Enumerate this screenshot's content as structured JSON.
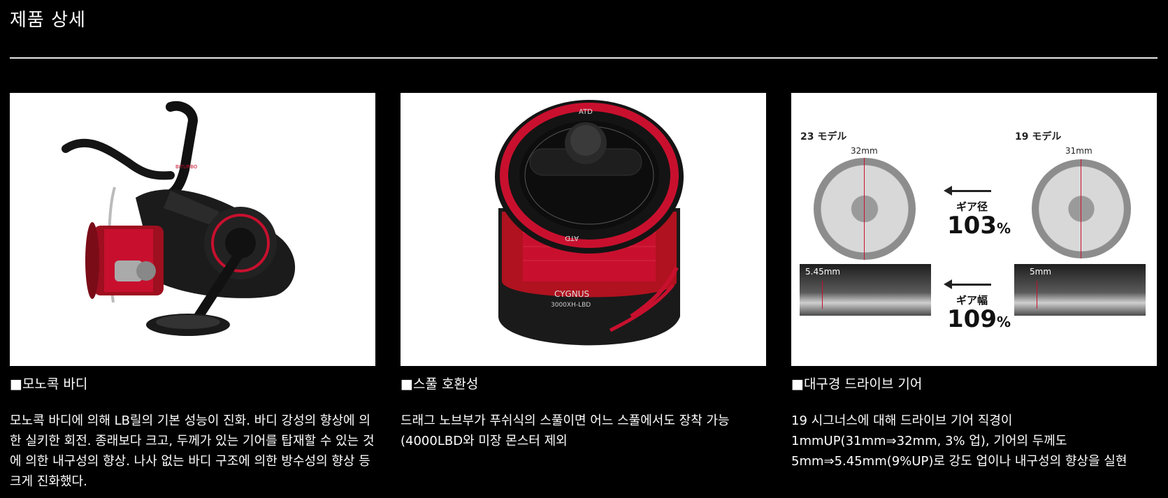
{
  "page": {
    "title": "제품 상세"
  },
  "cards": [
    {
      "caption": "■모노콕 바디",
      "description": "모노콕 바디에 의해 LB릴의 기본 성능이 진화. 바디 강성의 향상에 의한 실키한 회전. 종래보다 크고, 두께가 있는 기어를 탑재할 수 있는 것에 의한 내구성의 향상. 나사 없는 바디 구조에 의한 방수성의 향상 등 크게 진화했다.",
      "reel_label": "BITURBO"
    },
    {
      "caption": "■스풀 호환성",
      "description": "드래그 노브부가 푸쉬식의 스풀이면 어느 스풀에서도 장착 가능(4000LBD와 미장 몬스터 제외",
      "spool": {
        "top_text": "ATD",
        "bottom_text": "ATD",
        "brand": "CYGNUS",
        "model": "3000XH-LBD"
      }
    },
    {
      "caption": "■대구경 드라이브 기어",
      "description": "19 시그너스에 대해 드라이브 기어 직경이 1mmUP(31mm⇒32mm, 3% 업), 기어의 두께도 5mm⇒5.45mm(9%UP)로 강도 업이나 내구성의 향상을 실현",
      "diagram": {
        "left_model": "23 モデル",
        "right_model": "19 モデル",
        "left_diameter": "32mm",
        "right_diameter": "31mm",
        "diameter_label": "ギア径",
        "diameter_pct": "103",
        "width_label": "ギア幅",
        "width_pct": "109",
        "pct_unit": "%",
        "left_width": "5.45mm",
        "right_width": "5mm"
      }
    }
  ],
  "colors": {
    "background": "#000000",
    "text": "#ffffff",
    "accent_red": "#c8102e"
  }
}
